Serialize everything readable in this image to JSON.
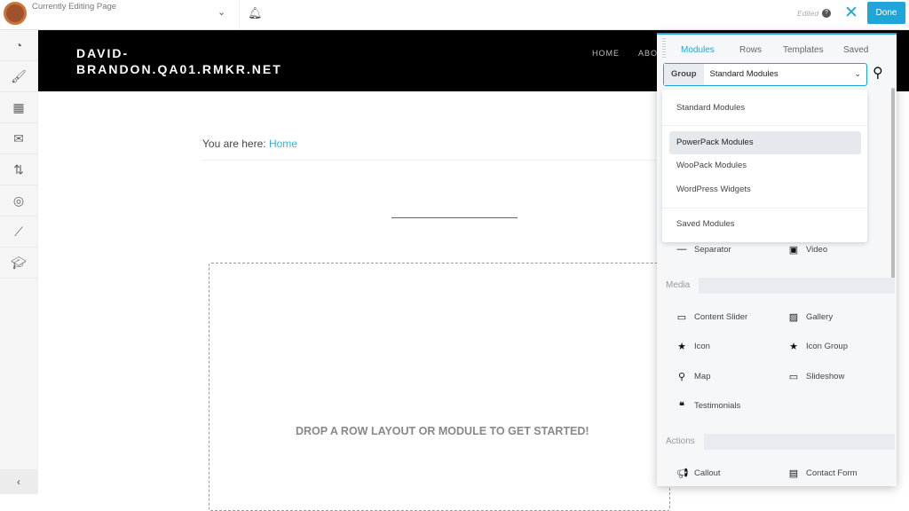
{
  "topbar": {
    "title": "Currently Editing Page",
    "edited": "Edited",
    "done": "Done"
  },
  "sidebar": {
    "icons": [
      "dashboard-icon",
      "brush-icon",
      "layout-icon",
      "mail-icon",
      "sort-icon",
      "target-icon",
      "chart-icon",
      "graduation-icon"
    ]
  },
  "site": {
    "title_line1": "DAVID-",
    "title_line2": "BRANDON.QA01.RMKR.NET",
    "nav": [
      "HOME",
      "ABOUT"
    ]
  },
  "breadcrumb": {
    "prefix": "You are here: ",
    "link": "Home"
  },
  "dropzone": {
    "text": "DROP A ROW LAYOUT OR MODULE TO GET STARTED!"
  },
  "panel": {
    "tabs": [
      "Modules",
      "Rows",
      "Templates",
      "Saved"
    ],
    "group_label": "Group",
    "group_value": "Standard Modules",
    "dropdown": [
      "Standard Modules",
      "PowerPack Modules",
      "WooPack Modules",
      "WordPress Widgets",
      "Saved Modules"
    ],
    "dropdown_highlighted": "PowerPack Modules",
    "row0": [
      "Separator",
      "Video"
    ],
    "media_label": "Media",
    "media": [
      "Content Slider",
      "Gallery",
      "Icon",
      "Icon Group",
      "Map",
      "Slideshow",
      "Testimonials"
    ],
    "actions_label": "Actions",
    "actions": [
      "Callout",
      "Contact Form"
    ]
  },
  "colors": {
    "accent": "#1fa6d9",
    "link": "#2bb7da"
  }
}
